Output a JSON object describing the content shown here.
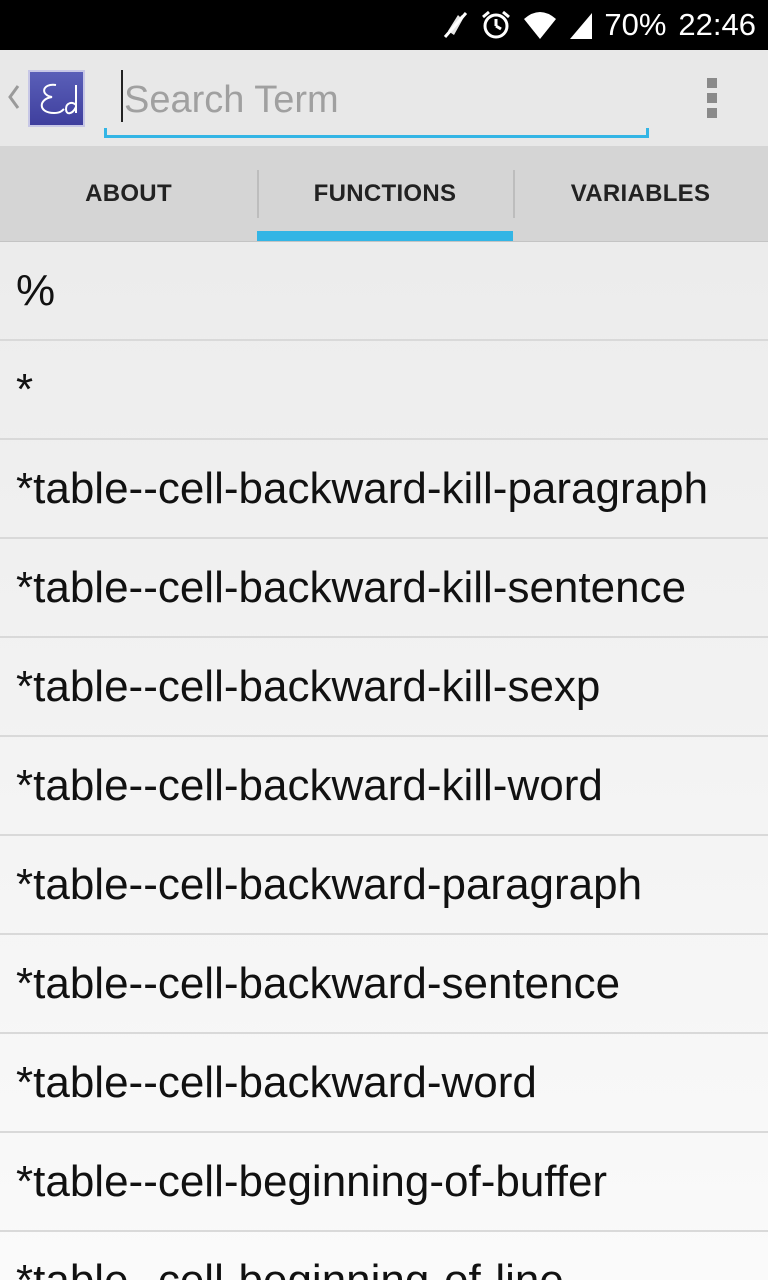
{
  "status_bar": {
    "battery": "70%",
    "time": "22:46",
    "icons": [
      "mute-icon",
      "alarm-icon",
      "wifi-icon",
      "signal-icon"
    ]
  },
  "action_bar": {
    "up_caret": "‹",
    "logo_text": "Ed",
    "search": {
      "placeholder": "Search Term",
      "value": ""
    }
  },
  "tabs": [
    {
      "label": "ABOUT",
      "selected": false
    },
    {
      "label": "FUNCTIONS",
      "selected": true
    },
    {
      "label": "VARIABLES",
      "selected": false
    }
  ],
  "accent_color": "#33b5e5",
  "list": {
    "items": [
      "%",
      "*",
      "*table--cell-backward-kill-paragraph",
      "*table--cell-backward-kill-sentence",
      "*table--cell-backward-kill-sexp",
      "*table--cell-backward-kill-word",
      "*table--cell-backward-paragraph",
      "*table--cell-backward-sentence",
      "*table--cell-backward-word",
      "*table--cell-beginning-of-buffer",
      "*table--cell-beginning-of-line"
    ]
  }
}
